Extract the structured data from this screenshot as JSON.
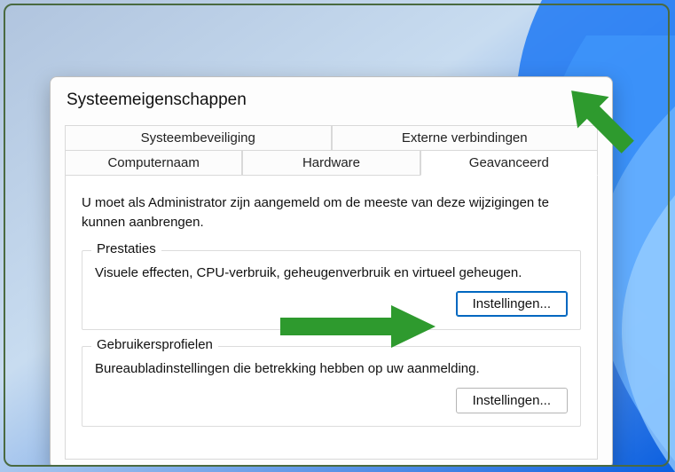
{
  "dialog": {
    "title": "Systeemeigenschappen"
  },
  "tabs": {
    "row1": [
      {
        "label": "Systeembeveiliging"
      },
      {
        "label": "Externe verbindingen"
      }
    ],
    "row2": [
      {
        "label": "Computernaam"
      },
      {
        "label": "Hardware"
      },
      {
        "label": "Geavanceerd",
        "active": true
      }
    ]
  },
  "panel": {
    "intro": "U moet als Administrator zijn aangemeld om de meeste van deze wijzigingen te kunnen aanbrengen.",
    "groups": {
      "perf": {
        "legend": "Prestaties",
        "desc": "Visuele effecten, CPU-verbruik, geheugenverbruik en virtueel geheugen.",
        "button": "Instellingen..."
      },
      "profiles": {
        "legend": "Gebruikersprofielen",
        "desc": "Bureaubladinstellingen die betrekking hebben op uw aanmelding.",
        "button": "Instellingen..."
      }
    }
  }
}
